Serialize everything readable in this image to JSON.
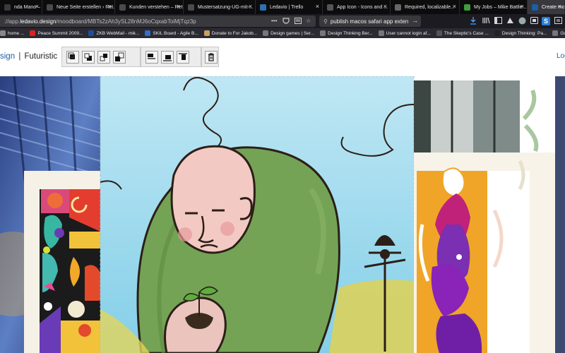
{
  "tabs": [
    {
      "label": "nda Mano – Uni...",
      "fav": "#3a3a3a"
    },
    {
      "label": "Neue Seite erstellen › Ret...",
      "fav": "#4a4a4a"
    },
    {
      "label": "Kunden verstehen – Retr...",
      "fav": "#4a4a4a"
    },
    {
      "label": "Mustersatzung-UG-mit-...",
      "fav": "#4a4a4a"
    },
    {
      "label": "Ledavio | Trello",
      "fav": "#2f6fb3"
    },
    {
      "label": "App Icon - Icons and ...",
      "fav": "#555"
    },
    {
      "label": "Required, localizable...",
      "fav": "#666"
    },
    {
      "label": "My Jobs – Mike Battle...",
      "fav": "#3f9d3a"
    },
    {
      "label": "Create moodb...",
      "fav": "#1a5fa8"
    }
  ],
  "url": {
    "prefix": "://app.",
    "host": "ledavio.design",
    "path": "/moodboard/MBTs2zAh3ySL28nMJ6oCqxabToiMjTqz3p"
  },
  "search": {
    "value": "publish macos safari app exten"
  },
  "bookmarks": [
    {
      "label": "home ...",
      "fav": "#888"
    },
    {
      "label": "Peace Summit 2009...",
      "fav": "#e02020"
    },
    {
      "label": "ZKB WebMail - mik...",
      "fav": "#1a4fa0"
    },
    {
      "label": "SKIL Board - Agile B...",
      "fav": "#2f6fd0"
    },
    {
      "label": "Donate to For Jakob...",
      "fav": "#c8a060"
    },
    {
      "label": "Design games | Ser...",
      "fav": "#777"
    },
    {
      "label": "Design Thinking Ber...",
      "fav": "#777"
    },
    {
      "label": "User cannot login af...",
      "fav": "#777"
    },
    {
      "label": "The Skeptic's Case ...",
      "fav": "#555"
    },
    {
      "label": "Design Thinking: Pa...",
      "fav": "#222"
    },
    {
      "label": "Google",
      "fav": "#777"
    }
  ],
  "app": {
    "brand_part1": "sign",
    "brand_sep": "|",
    "brand_part2": "Futuristic",
    "login_label": "Log"
  },
  "toolbar": {
    "groups": [
      [
        "bring-to-front",
        "send-backward",
        "bring-forward",
        "send-to-back"
      ],
      [
        "align-left",
        "align-bottom",
        "align-top"
      ],
      [
        "delete"
      ]
    ]
  },
  "colors": {
    "accent": "#1a5fa8",
    "tab_bg": "#0c0c0d",
    "nav_bg": "#1c1b22",
    "urlbar_bg": "#38383d"
  }
}
